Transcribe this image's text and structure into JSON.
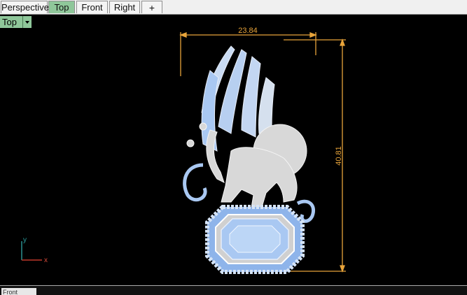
{
  "tabs": [
    {
      "label": "Perspective"
    },
    {
      "label": "Top"
    },
    {
      "label": "Front"
    },
    {
      "label": "Right"
    }
  ],
  "add_tab_glyph": "+",
  "viewport": {
    "label": "Top",
    "dimensions": {
      "width": "23.84",
      "height": "40.81"
    },
    "axes": {
      "y": "y",
      "x": "x"
    }
  },
  "bottom_tab_label": "Front",
  "colors": {
    "active_tab": "#8fc79a",
    "dimension": "#e8a43a",
    "gem": "#a9c8f2",
    "metal": "#d8d8d8",
    "axis_x": "#c0392b",
    "axis_y": "#2a8f8f"
  }
}
